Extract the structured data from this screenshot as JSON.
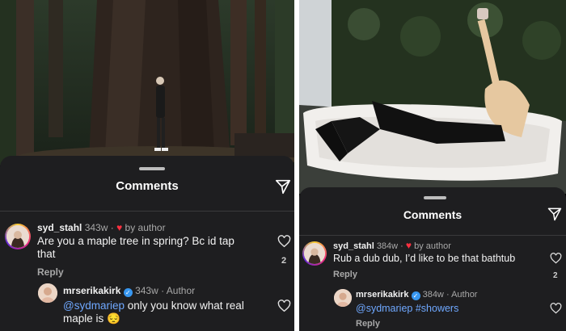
{
  "left": {
    "sheet_title": "Comments",
    "comments": [
      {
        "username": "syd_stahl",
        "age": "343w",
        "separator": "·",
        "liked_by_author": "by author",
        "text": "Are you a maple tree in spring? Bc id tap that",
        "reply_label": "Reply",
        "like_count": "2"
      },
      {
        "username": "mrserikakirk",
        "age": "343w",
        "separator": "·",
        "role": "Author",
        "mention": "@sydmariep",
        "text": " only you know what real maple is 😔"
      }
    ]
  },
  "right": {
    "sheet_title": "Comments",
    "comments": [
      {
        "username": "syd_stahl",
        "age": "384w",
        "separator": "·",
        "liked_by_author": "by author",
        "text": "Rub a dub dub, I’d like to be that bathtub",
        "reply_label": "Reply",
        "like_count": "2"
      },
      {
        "username": "mrserikakirk",
        "age": "384w",
        "separator": "·",
        "role": "Author",
        "mention": "@sydmariep",
        "hashtag": "#showers",
        "reply_label": "Reply"
      }
    ]
  },
  "icons": {
    "send": "paper-plane-icon",
    "like": "heart-outline-icon",
    "liked_by_author": "heart-filled-icon",
    "verified": "verified-badge-icon"
  },
  "colors": {
    "sheet_bg": "#1e1e20",
    "text": "#f2f2f2",
    "muted": "#a8a8a8",
    "mention": "#6fa8ff",
    "liked_heart": "#ff3040",
    "verified": "#3897f0"
  }
}
